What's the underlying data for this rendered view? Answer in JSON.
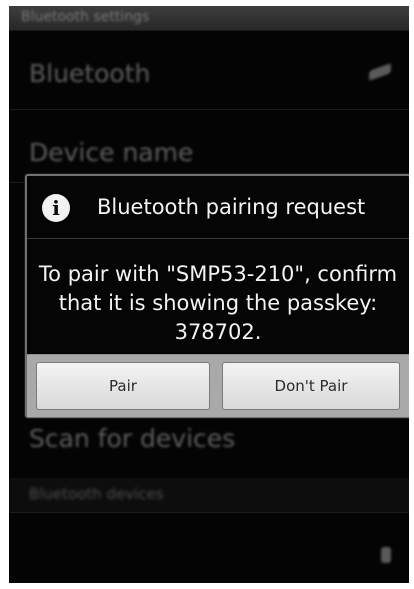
{
  "status_bar": {
    "title": "Bluetooth settings"
  },
  "background": {
    "rows": [
      {
        "label": "Bluetooth"
      },
      {
        "label": "Device name"
      },
      {
        "label": "Scan for devices"
      }
    ],
    "section_header": "Bluetooth devices"
  },
  "dialog": {
    "icon": "info-icon",
    "title": "Bluetooth pairing request",
    "message": "To pair with \"SMP53-210\", confirm that it is showing the passkey: 378702.",
    "buttons": {
      "pair": "Pair",
      "dont_pair": "Don't Pair"
    }
  },
  "colors": {
    "dialog_bg": "#050505",
    "button_bar": "#a9a9a9",
    "button_face": "#e6e6e6"
  }
}
